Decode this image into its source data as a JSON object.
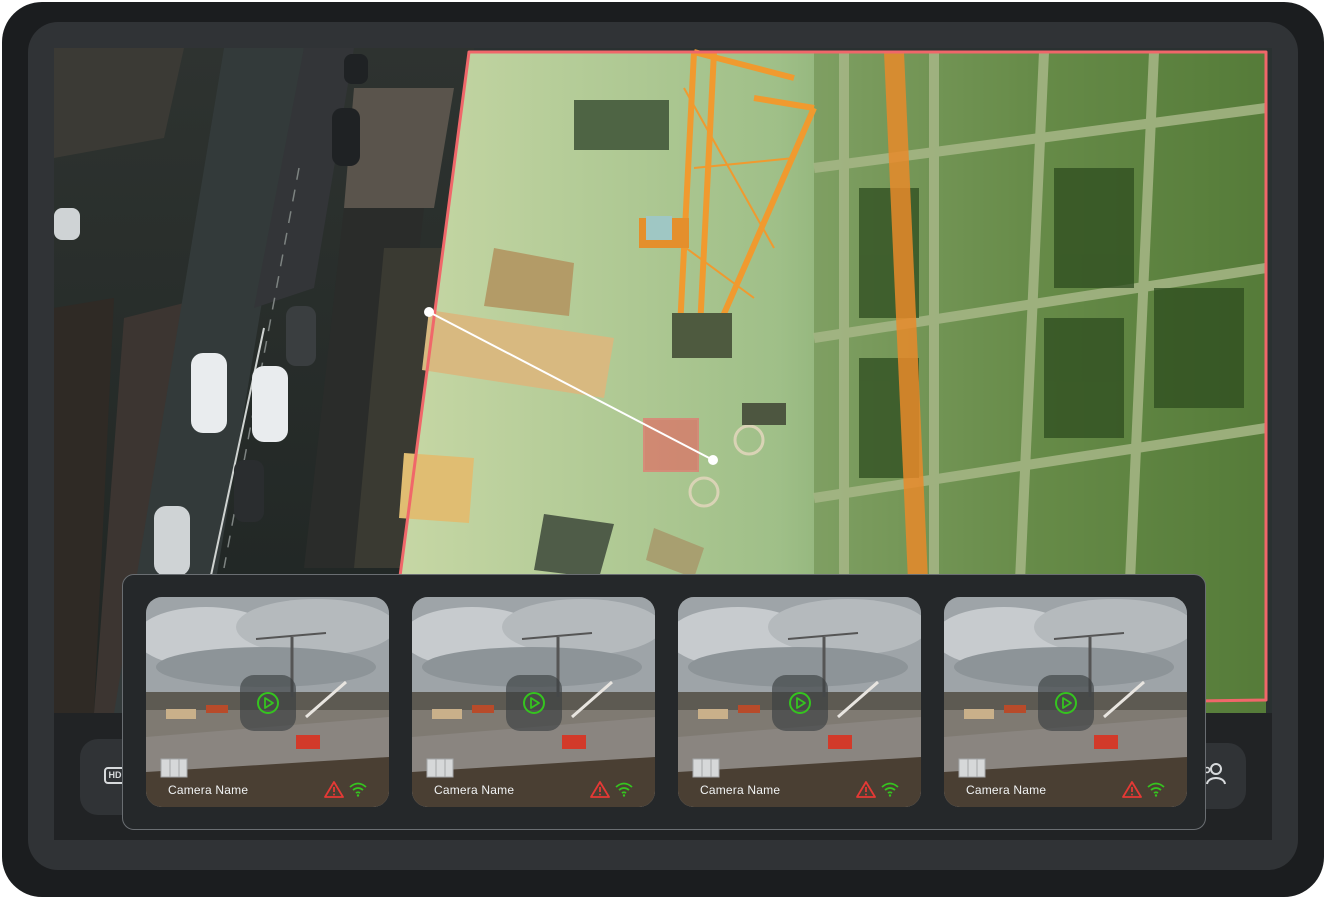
{
  "colors": {
    "zone_outline": "#f0676a",
    "alert": "#e53935",
    "signal": "#35c41f",
    "play": "#35c41f"
  },
  "icons": {
    "quality": "hd-icon",
    "users": "user-icon",
    "play": "play-icon",
    "alert": "alert-triangle-icon",
    "signal": "wifi-icon"
  },
  "toolbar": {
    "hd_label": "HD"
  },
  "cameras": [
    {
      "name": "Camera Name"
    },
    {
      "name": "Camera Name"
    },
    {
      "name": "Camera Name"
    },
    {
      "name": "Camera Name"
    }
  ]
}
